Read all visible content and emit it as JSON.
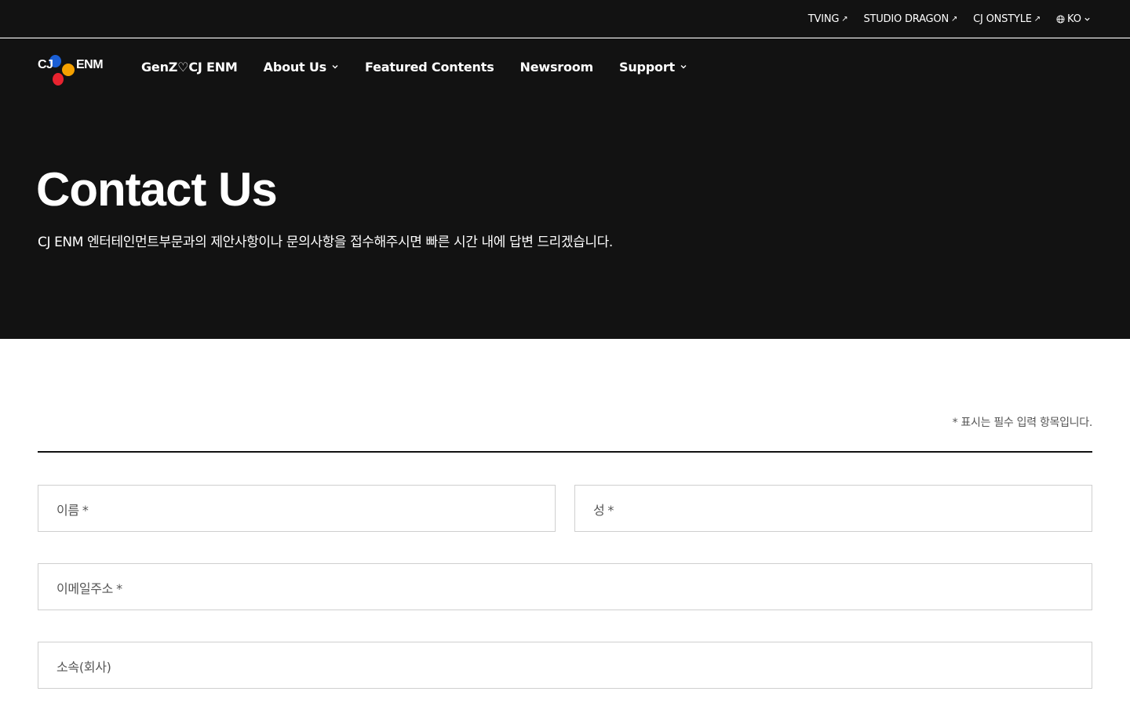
{
  "utility_links": [
    {
      "label": "TVING"
    },
    {
      "label": "STUDIO DRAGON"
    },
    {
      "label": "CJ ONSTYLE"
    }
  ],
  "language": {
    "current": "KO"
  },
  "logo": {
    "left_text": "CJ",
    "right_text": "ENM"
  },
  "nav": {
    "items": [
      {
        "label": "GenZ♡CJ ENM"
      },
      {
        "label": "About Us"
      },
      {
        "label": "Featured Contents"
      },
      {
        "label": "Newsroom"
      },
      {
        "label": "Support"
      }
    ]
  },
  "hero": {
    "title": "Contact Us",
    "subtitle": "CJ ENM 엔터테인먼트부문과의 제안사항이나 문의사항을 접수해주시면 빠른 시간 내에 답변 드리겠습니다."
  },
  "form": {
    "required_note": "* 표시는 필수 입력 항목입니다.",
    "required_marker": "*",
    "fields": {
      "first_name": {
        "label": "이름"
      },
      "last_name": {
        "label": "성"
      },
      "email": {
        "label": "이메일주소"
      },
      "company": {
        "label": "소속(회사)"
      }
    }
  },
  "colors": {
    "header_bg": "#121212",
    "logo_blue": "#1a5fd6",
    "logo_orange": "#f5a100",
    "logo_red": "#e8232f"
  }
}
